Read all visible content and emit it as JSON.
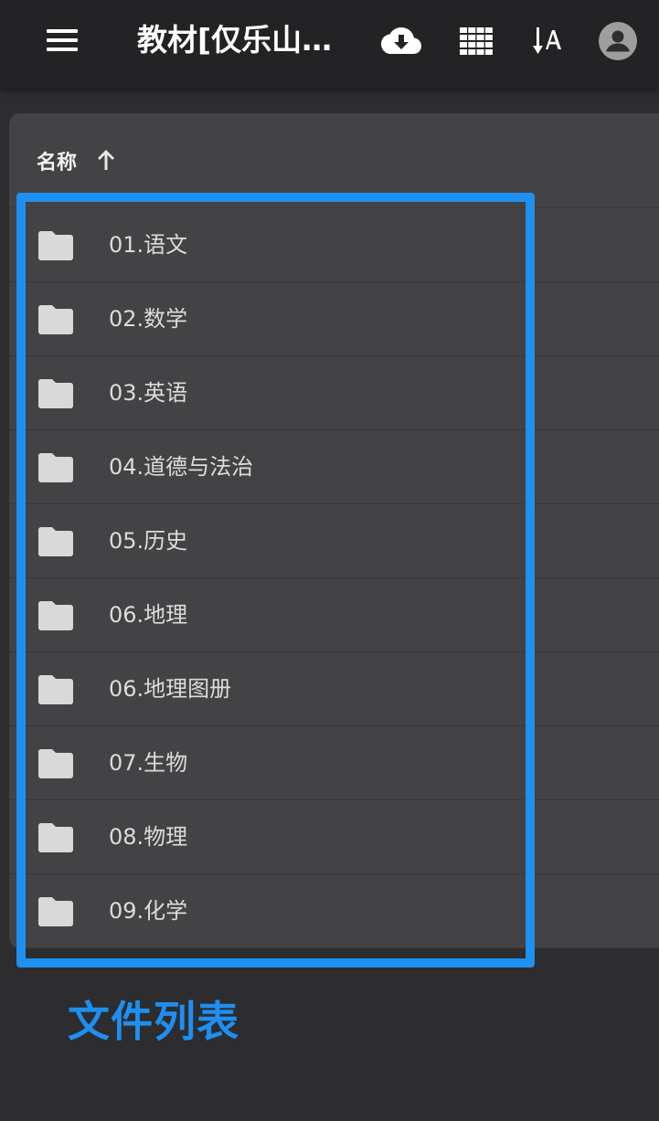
{
  "topbar": {
    "title": "教材[仅乐山…",
    "icons": [
      "menu-icon",
      "cloud-download-icon",
      "grid-view-icon",
      "sort-alpha-icon",
      "account-icon"
    ]
  },
  "list_header": {
    "name_label": "名称",
    "sort_direction": "ascending"
  },
  "files": [
    {
      "name": "01.语文",
      "type": "folder"
    },
    {
      "name": "02.数学",
      "type": "folder"
    },
    {
      "name": "03.英语",
      "type": "folder"
    },
    {
      "name": "04.道德与法治",
      "type": "folder"
    },
    {
      "name": "05.历史",
      "type": "folder"
    },
    {
      "name": "06.地理",
      "type": "folder"
    },
    {
      "name": "06.地理图册",
      "type": "folder"
    },
    {
      "name": "07.生物",
      "type": "folder"
    },
    {
      "name": "08.物理",
      "type": "folder"
    },
    {
      "name": "09.化学",
      "type": "folder"
    }
  ],
  "annotation": {
    "label": "文件列表",
    "color": "#1e90f0"
  },
  "colors": {
    "topbar": "#232225",
    "background": "#2d2c2f",
    "panel": "#434245",
    "folder_icon": "#d9d9d9",
    "row_text": "#dcdcdc"
  }
}
